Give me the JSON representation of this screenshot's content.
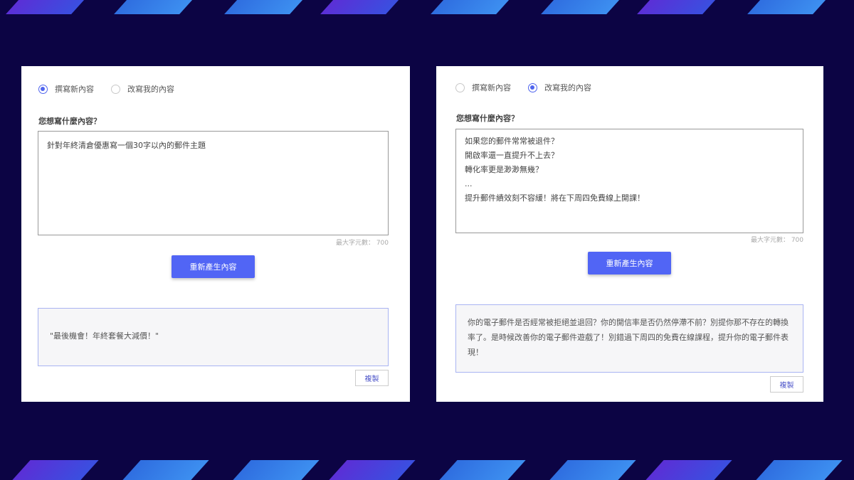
{
  "left": {
    "options": [
      "撰寫新內容",
      "改寫我的內容"
    ],
    "selected_index": 0,
    "question": "您想寫什麼內容？",
    "input_text": "針對年終清倉優惠寫一個30字以內的郵件主題",
    "max_chars_label": "最大字元數：  700",
    "regenerate_label": "重新產生內容",
    "result_text": "\"最後機會！年終套餐大減價！\"",
    "copy_label": "複製"
  },
  "right": {
    "options": [
      "撰寫新內容",
      "改寫我的內容"
    ],
    "selected_index": 1,
    "question": "您想寫什麼內容？",
    "input_text": "如果您的郵件常常被退件？\n開啟率還一直提升不上去？\n轉化率更是渺渺無幾？\n...\n提升郵件績效刻不容緩！將在下周四免費線上開課！",
    "max_chars_label": "最大字元數：  700",
    "regenerate_label": "重新產生內容",
    "result_text": "你的電子郵件是否經常被拒絕並退回？你的開信率是否仍然停滯不前？別提你那不存在的轉換率了。是時候改善你的電子郵件遊戲了！別錯過下周四的免費在線課程，提升你的電子郵件表現！",
    "copy_label": "複製"
  },
  "colors": {
    "background": "#0c0444",
    "accent": "#5165f5",
    "result_border": "#a9b4f2"
  }
}
